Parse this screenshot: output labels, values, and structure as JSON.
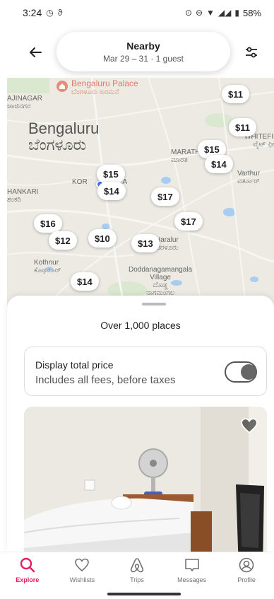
{
  "status_bar": {
    "time": "3:24",
    "battery": "58%"
  },
  "header": {
    "search_title": "Nearby",
    "search_subtitle": "Mar 29 – 31 · 1 guest"
  },
  "map": {
    "palace_name": "Bengaluru Palace",
    "palace_name_local": "ಬೆಂಗಳೂರು ಅರಮನೆ",
    "city_name": "Bengaluru",
    "city_name_local": "ಬೆಂಗಳೂರು",
    "labels": {
      "rajinagar": "AJINAGAR",
      "rajinagar_local": "ಜಾಜಿನಗರ",
      "hankari": "HANKARI",
      "hankari_local": "ಶಂಕರಿ",
      "kora": "KOR",
      "kora_suffix": "LA",
      "whitefield": "WHITEFIEL",
      "whitefield_local": "ವೈಟ್ ಫೀಲ್ಡ್",
      "marath": "MARATH",
      "marath_local": "ಮಾರತ",
      "varthur": "Varthur",
      "varthur_local": "ವರ್ತೂರ್",
      "haralur": "Haralur",
      "haralur_local": "ಹರಳೂರು",
      "kothnur": "Kothnur",
      "kothnur_local": "ಕೊಥನೂರ್",
      "doddanagamangala": "Doddanagamangala",
      "village": "Village",
      "village_local": "ದೊಡ್ಡ",
      "village_local2": "ನಾಗಮಂಗಲ"
    },
    "price_pins": [
      "$11",
      "$11",
      "$15",
      "$14",
      "$15",
      "$14",
      "$17",
      "$17",
      "$16",
      "$12",
      "$10",
      "$13",
      "$14"
    ]
  },
  "sheet": {
    "places_count": "Over 1,000 places",
    "total_price_title": "Display total price",
    "total_price_subtitle": "Includes all fees, before taxes",
    "toggle_on": false
  },
  "tabs": [
    {
      "label": "Explore",
      "icon": "search-icon",
      "active": true
    },
    {
      "label": "Wishlists",
      "icon": "heart-icon",
      "active": false
    },
    {
      "label": "Trips",
      "icon": "airbnb-icon",
      "active": false
    },
    {
      "label": "Messages",
      "icon": "message-icon",
      "active": false
    },
    {
      "label": "Profile",
      "icon": "profile-icon",
      "active": false
    }
  ],
  "colors": {
    "accent": "#e31c5f",
    "map_water": "#a9cdf0",
    "location_dot": "#3b7bf2"
  }
}
